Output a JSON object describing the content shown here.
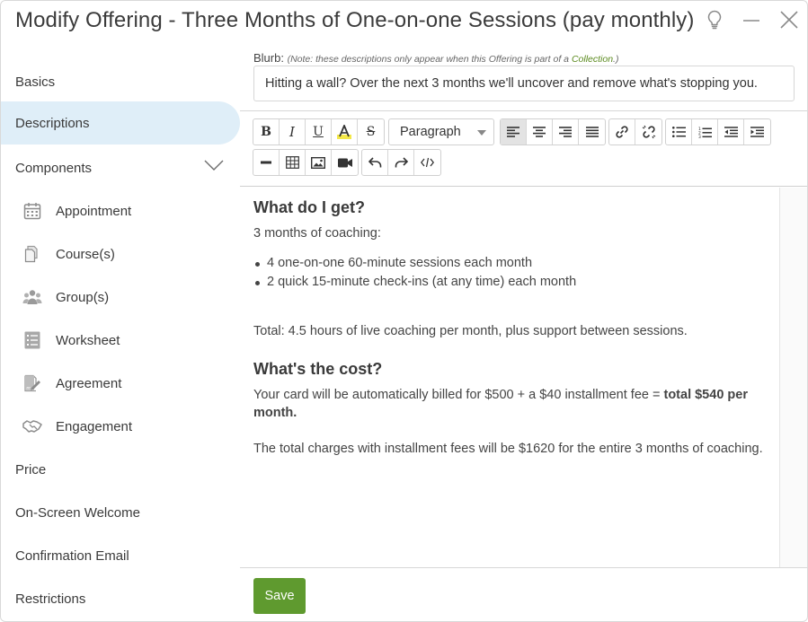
{
  "window": {
    "title": "Modify Offering - Three Months of One-on-one Sessions (pay monthly)"
  },
  "sidebar": {
    "items": [
      {
        "label": "Basics"
      },
      {
        "label": "Descriptions",
        "active": true
      },
      {
        "label": "Components",
        "expanded": true
      },
      {
        "label": "Appointment",
        "icon": "calendar-icon"
      },
      {
        "label": "Course(s)",
        "icon": "documents-icon"
      },
      {
        "label": "Group(s)",
        "icon": "group-icon"
      },
      {
        "label": "Worksheet",
        "icon": "worksheet-icon"
      },
      {
        "label": "Agreement",
        "icon": "signature-icon"
      },
      {
        "label": "Engagement",
        "icon": "handshake-icon"
      },
      {
        "label": "Price"
      },
      {
        "label": "On-Screen Welcome"
      },
      {
        "label": "Confirmation Email"
      },
      {
        "label": "Restrictions"
      }
    ]
  },
  "blurb": {
    "label": "Blurb:",
    "note_prefix": "(Note: these descriptions only appear when this Offering is part of a ",
    "note_link": "Collection",
    "note_suffix": ".)",
    "value": "Hitting a wall? Over the next 3 months we'll uncover and remove what's stopping you."
  },
  "toolbar": {
    "paragraph_format": "Paragraph",
    "active_alignment": "align-left"
  },
  "document": {
    "heading1": "What do I get?",
    "intro": "3 months of coaching:",
    "bullets": [
      "4 one-on-one 60-minute sessions each month",
      "2 quick 15-minute check-ins (at any time) each month"
    ],
    "total": "Total: 4.5 hours of live coaching per month, plus support between sessions.",
    "heading2": "What's the cost?",
    "cost_text": "Your card will be automatically billed for $500 + a $40 installment fee = ",
    "cost_bold": "total $540 per month.",
    "charges": "The total charges with installment fees will be $1620 for the entire 3 months of coaching."
  },
  "footer": {
    "save_label": "Save"
  },
  "colors": {
    "accent_active_nav": "#dfeef8",
    "save_button": "#5f9a2f",
    "link": "#5b8a1e"
  }
}
